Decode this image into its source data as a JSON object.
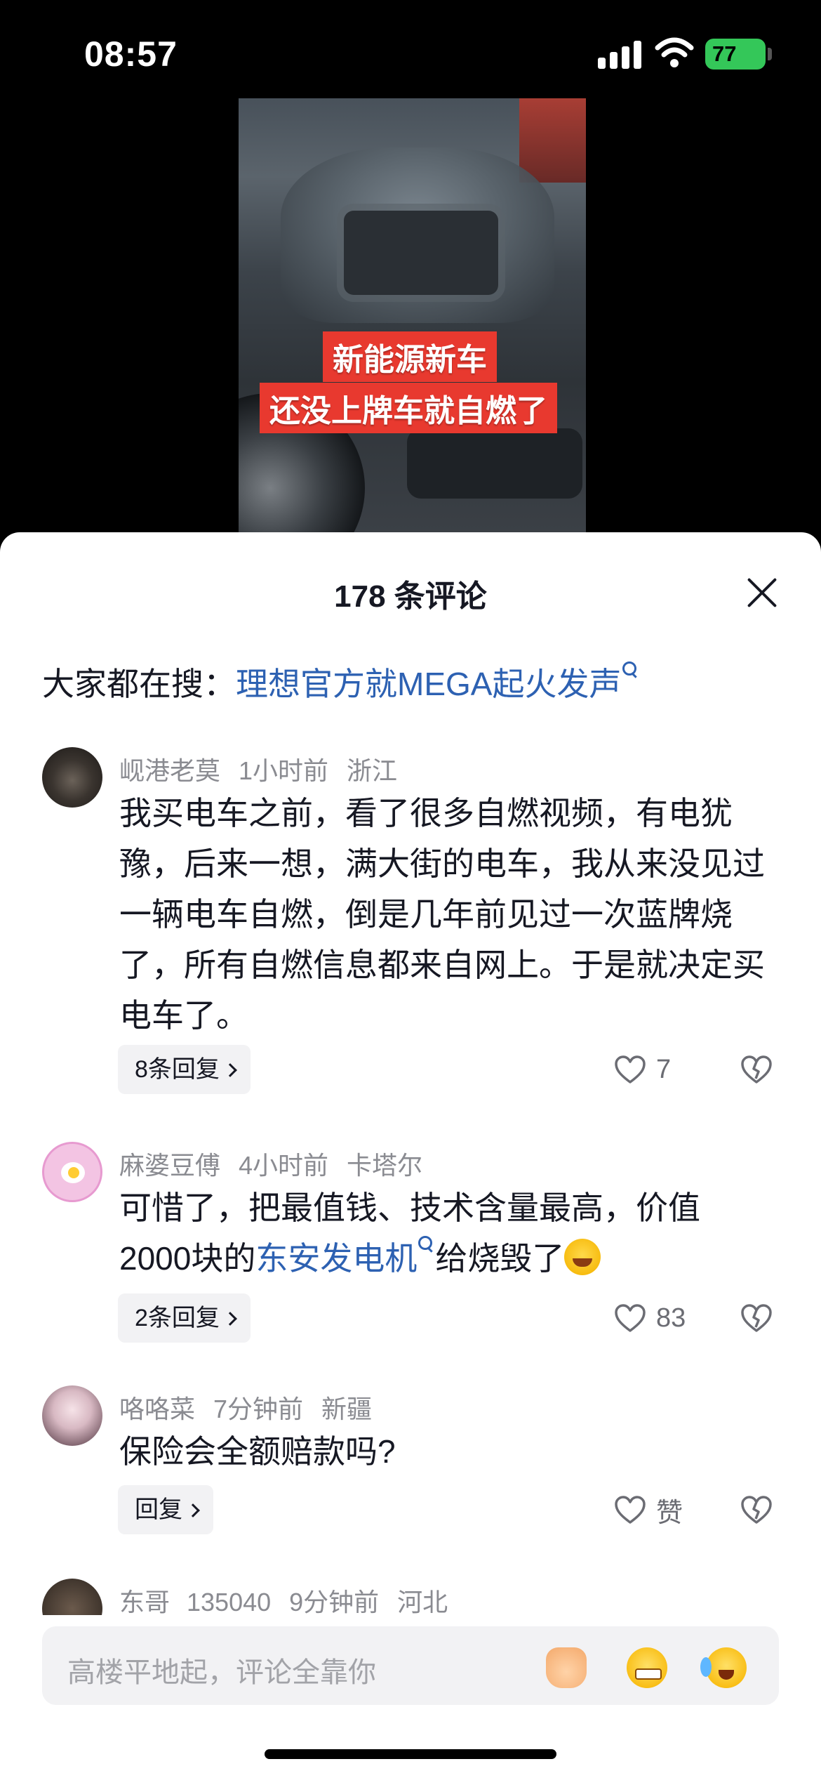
{
  "status_bar": {
    "time": "08:57",
    "battery": "77"
  },
  "video": {
    "caption_line1": "新能源新车",
    "caption_line2": "还没上牌车就自燃了"
  },
  "sheet": {
    "title": "178 条评论"
  },
  "search_hint": {
    "prefix": "大家都在搜：",
    "link": "理想官方就MEGA起火发声"
  },
  "comments": [
    {
      "author": "岘港老莫",
      "time": "1小时前",
      "location": "浙江",
      "text": "我买电车之前，看了很多自燃视频，有电犹豫，后来一想，满大街的电车，我从来没见过一辆电车自燃，倒是几年前见过一次蓝牌烧了，所有自燃信息都来自网上。于是就决定买电车了。",
      "replies": "8条回复",
      "likes": "7"
    },
    {
      "author": "麻婆豆傅",
      "time": "4小时前",
      "location": "卡塔尔",
      "text_before": "可惜了，把最值钱、技术含量最高，价值2000块的",
      "text_link": "东安发电机",
      "text_after": "给烧毁了",
      "replies": "2条回复",
      "likes": "83"
    },
    {
      "author": "咯咯菜",
      "time": "7分钟前",
      "location": "新疆",
      "text": "保险会全额赔款吗?",
      "replies": "回复",
      "likes": "赞"
    },
    {
      "author": "东哥 135040",
      "time": "9分钟前",
      "location": "河北"
    }
  ],
  "input": {
    "placeholder": "高楼平地起，评论全靠你"
  },
  "icons": [
    "signal-icon",
    "wifi-icon",
    "close-icon",
    "search-icon",
    "heart-icon",
    "dislike-heart-icon",
    "pray-emoji-icon",
    "grin-emoji-icon",
    "laugh-cry-emoji-icon"
  ]
}
